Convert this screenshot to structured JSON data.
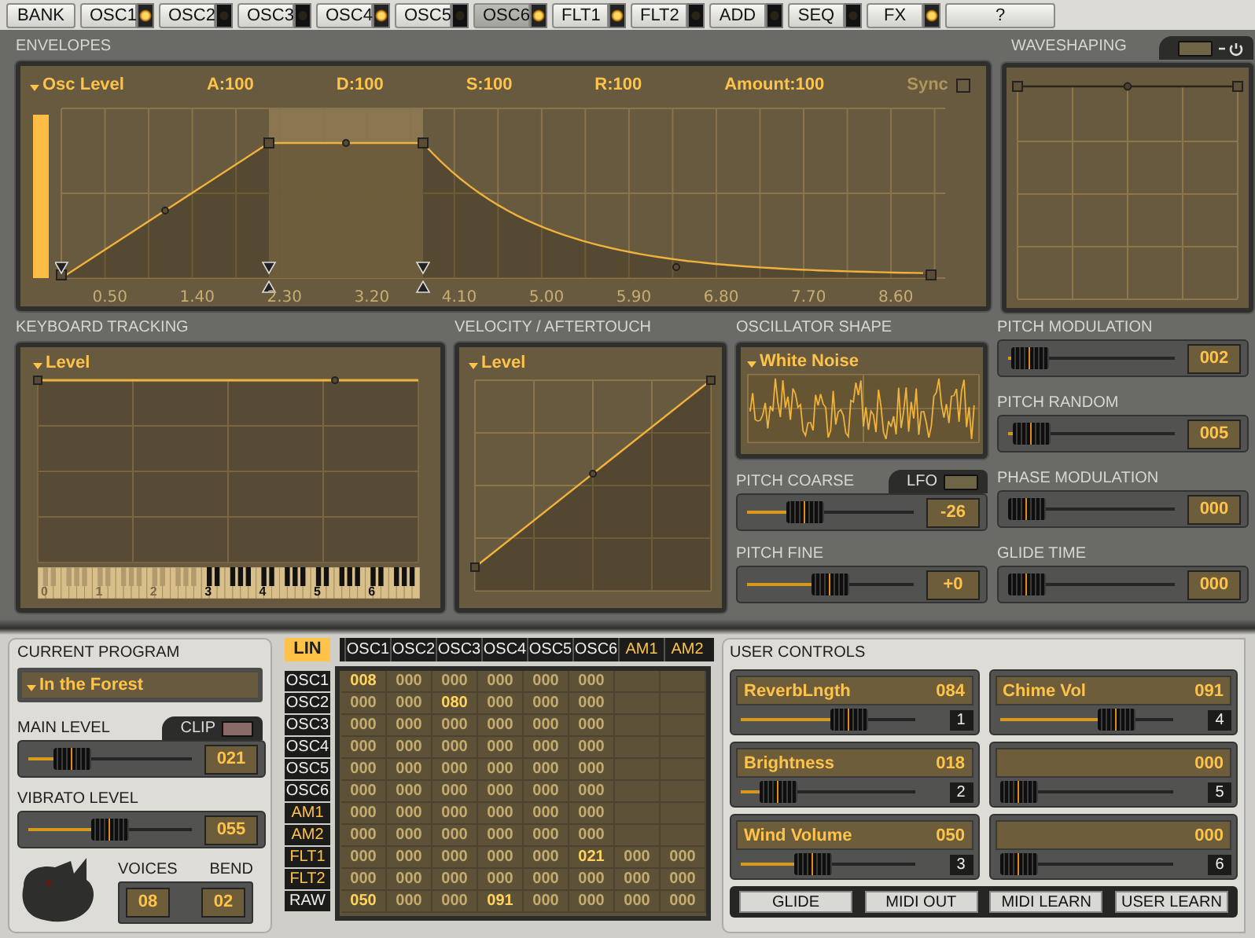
{
  "tabs": [
    {
      "label": "BANK",
      "kind": "plain",
      "selected": false
    },
    {
      "label": "OSC1",
      "kind": "module",
      "led_on": true,
      "selected": false
    },
    {
      "label": "OSC2",
      "kind": "module",
      "led_on": false,
      "selected": false
    },
    {
      "label": "OSC3",
      "kind": "module",
      "led_on": false,
      "selected": false
    },
    {
      "label": "OSC4",
      "kind": "module",
      "led_on": true,
      "selected": false
    },
    {
      "label": "OSC5",
      "kind": "module",
      "led_on": false,
      "selected": false
    },
    {
      "label": "OSC6",
      "kind": "module",
      "led_on": true,
      "selected": true
    },
    {
      "label": "FLT1",
      "kind": "module",
      "led_on": true,
      "selected": false
    },
    {
      "label": "FLT2",
      "kind": "module",
      "led_on": false,
      "selected": false
    },
    {
      "label": "ADD",
      "kind": "module",
      "led_on": false,
      "selected": false
    },
    {
      "label": "SEQ",
      "kind": "module",
      "led_on": false,
      "selected": false
    },
    {
      "label": "FX",
      "kind": "module",
      "led_on": true,
      "selected": false
    },
    {
      "label": "?",
      "kind": "plain",
      "selected": false
    }
  ],
  "envelopes": {
    "title": "ENVELOPES",
    "target": "Osc Level",
    "params": [
      "A:100",
      "D:100",
      "S:100",
      "R:100",
      "Amount:100"
    ],
    "sync_label": "Sync",
    "sync_checked": false,
    "level": 1,
    "time_labels": [
      "0.50",
      "1.40",
      "2.30",
      "3.20",
      "4.10",
      "5.00",
      "5.90",
      "6.80",
      "7.70",
      "8.60"
    ]
  },
  "waveshaping": {
    "title": "WAVESHAPING",
    "power_on": false
  },
  "keyboard_tracking": {
    "title": "KEYBOARD TRACKING",
    "target": "Level",
    "octave_labels": [
      "0",
      "1",
      "2",
      "3",
      "4",
      "5",
      "6"
    ]
  },
  "velocity": {
    "title": "VELOCITY / AFTERTOUCH",
    "target": "Level"
  },
  "oscillator_shape": {
    "title": "OSCILLATOR SHAPE",
    "waveform": "White Noise"
  },
  "pitch_controls": [
    {
      "label": "PITCH COARSE",
      "value": "-26",
      "level": 0.3,
      "lfo": {
        "label": "LFO",
        "on": false
      }
    },
    {
      "label": "PITCH FINE",
      "value": "+0",
      "level": 0.5
    }
  ],
  "modulation_controls": [
    {
      "label": "PITCH MODULATION",
      "value": "002",
      "level": 0.02
    },
    {
      "label": "PITCH RANDOM",
      "value": "005",
      "level": 0.04
    },
    {
      "label": "PHASE MODULATION",
      "value": "000",
      "level": 0
    },
    {
      "label": "GLIDE TIME",
      "value": "000",
      "level": 0
    }
  ],
  "program": {
    "title": "CURRENT PROGRAM",
    "name": "In the Forest",
    "main_level": {
      "label": "MAIN LEVEL",
      "value": "021",
      "level": 0.2,
      "clip_label": "CLIP",
      "clip_on": false
    },
    "vibrato_level": {
      "label": "VIBRATO LEVEL",
      "value": "055",
      "level": 0.5
    },
    "voices": {
      "label": "VOICES",
      "value": "08"
    },
    "bend": {
      "label": "BEND",
      "value": "02"
    }
  },
  "matrix": {
    "mode": {
      "label": "LIN",
      "on": true
    },
    "columns": [
      {
        "label": "OSC1",
        "kind": "osc"
      },
      {
        "label": "OSC2",
        "kind": "osc"
      },
      {
        "label": "OSC3",
        "kind": "osc"
      },
      {
        "label": "OSC4",
        "kind": "osc"
      },
      {
        "label": "OSC5",
        "kind": "osc"
      },
      {
        "label": "OSC6",
        "kind": "osc"
      },
      {
        "label": "AM1",
        "kind": "mod"
      },
      {
        "label": "AM2",
        "kind": "mod"
      }
    ],
    "rows": [
      {
        "label": "OSC1",
        "kind": "osc",
        "cells": [
          {
            "value": "008",
            "active": true
          },
          {
            "value": "000",
            "active": false
          },
          {
            "value": "000",
            "active": false
          },
          {
            "value": "000",
            "active": false
          },
          {
            "value": "000",
            "active": false
          },
          {
            "value": "000",
            "active": false
          }
        ]
      },
      {
        "label": "OSC2",
        "kind": "osc",
        "cells": [
          {
            "value": "000",
            "active": false
          },
          {
            "value": "000",
            "active": false
          },
          {
            "value": "080",
            "active": true
          },
          {
            "value": "000",
            "active": false
          },
          {
            "value": "000",
            "active": false
          },
          {
            "value": "000",
            "active": false
          }
        ]
      },
      {
        "label": "OSC3",
        "kind": "osc",
        "cells": [
          {
            "value": "000",
            "active": false
          },
          {
            "value": "000",
            "active": false
          },
          {
            "value": "000",
            "active": false
          },
          {
            "value": "000",
            "active": false
          },
          {
            "value": "000",
            "active": false
          },
          {
            "value": "000",
            "active": false
          }
        ]
      },
      {
        "label": "OSC4",
        "kind": "osc",
        "cells": [
          {
            "value": "000",
            "active": false
          },
          {
            "value": "000",
            "active": false
          },
          {
            "value": "000",
            "active": false
          },
          {
            "value": "000",
            "active": false
          },
          {
            "value": "000",
            "active": false
          },
          {
            "value": "000",
            "active": false
          }
        ]
      },
      {
        "label": "OSC5",
        "kind": "osc",
        "cells": [
          {
            "value": "000",
            "active": false
          },
          {
            "value": "000",
            "active": false
          },
          {
            "value": "000",
            "active": false
          },
          {
            "value": "000",
            "active": false
          },
          {
            "value": "000",
            "active": false
          },
          {
            "value": "000",
            "active": false
          }
        ]
      },
      {
        "label": "OSC6",
        "kind": "osc",
        "cells": [
          {
            "value": "000",
            "active": false
          },
          {
            "value": "000",
            "active": false
          },
          {
            "value": "000",
            "active": false
          },
          {
            "value": "000",
            "active": false
          },
          {
            "value": "000",
            "active": false
          },
          {
            "value": "000",
            "active": false
          }
        ]
      },
      {
        "label": "AM1",
        "kind": "mod",
        "cells": [
          {
            "value": "000",
            "active": false
          },
          {
            "value": "000",
            "active": false
          },
          {
            "value": "000",
            "active": false
          },
          {
            "value": "000",
            "active": false
          },
          {
            "value": "000",
            "active": false
          },
          {
            "value": "000",
            "active": false
          }
        ]
      },
      {
        "label": "AM2",
        "kind": "mod",
        "cells": [
          {
            "value": "000",
            "active": false
          },
          {
            "value": "000",
            "active": false
          },
          {
            "value": "000",
            "active": false
          },
          {
            "value": "000",
            "active": false
          },
          {
            "value": "000",
            "active": false
          },
          {
            "value": "000",
            "active": false
          }
        ]
      },
      {
        "label": "FLT1",
        "kind": "mod",
        "cells": [
          {
            "value": "000",
            "active": false
          },
          {
            "value": "000",
            "active": false
          },
          {
            "value": "000",
            "active": false
          },
          {
            "value": "000",
            "active": false
          },
          {
            "value": "000",
            "active": false
          },
          {
            "value": "021",
            "active": true
          },
          {
            "value": "000",
            "active": false
          },
          {
            "value": "000",
            "active": false
          }
        ]
      },
      {
        "label": "FLT2",
        "kind": "mod",
        "cells": [
          {
            "value": "000",
            "active": false
          },
          {
            "value": "000",
            "active": false
          },
          {
            "value": "000",
            "active": false
          },
          {
            "value": "000",
            "active": false
          },
          {
            "value": "000",
            "active": false
          },
          {
            "value": "000",
            "active": false
          },
          {
            "value": "000",
            "active": false
          },
          {
            "value": "000",
            "active": false
          }
        ]
      },
      {
        "label": "RAW",
        "kind": "osc",
        "cells": [
          {
            "value": "050",
            "active": true
          },
          {
            "value": "000",
            "active": false
          },
          {
            "value": "000",
            "active": false
          },
          {
            "value": "091",
            "active": true
          },
          {
            "value": "000",
            "active": false
          },
          {
            "value": "000",
            "active": false
          },
          {
            "value": "000",
            "active": false
          },
          {
            "value": "000",
            "active": false
          }
        ]
      }
    ]
  },
  "user_controls": {
    "title": "USER CONTROLS",
    "items": [
      {
        "name": "ReverbLngth",
        "value": "084",
        "level": 0.66,
        "slot": "1"
      },
      {
        "name": "Brightness",
        "value": "018",
        "level": 0.14,
        "slot": "2"
      },
      {
        "name": "Wind Volume",
        "value": "050",
        "level": 0.39,
        "slot": "3"
      },
      {
        "name": "Chime Vol",
        "value": "091",
        "level": 0.72,
        "slot": "4"
      },
      {
        "value": "000",
        "level": 0,
        "slot": "5"
      },
      {
        "value": "000",
        "level": 0,
        "slot": "6"
      }
    ],
    "buttons": [
      "GLIDE",
      "MIDI OUT",
      "MIDI LEARN",
      "USER LEARN"
    ]
  }
}
